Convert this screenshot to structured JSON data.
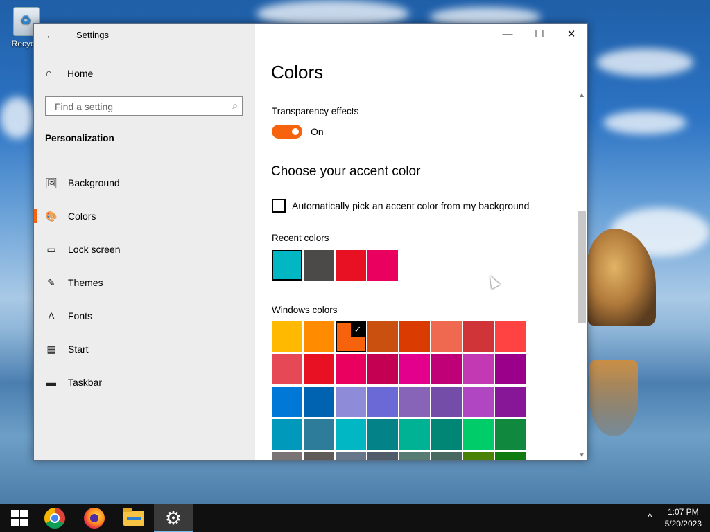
{
  "desktop": {
    "recycle_bin_label": "Recycle"
  },
  "window": {
    "title": "Settings",
    "back_glyph": "←",
    "minimize_glyph": "—",
    "maximize_glyph": "☐",
    "close_glyph": "✕"
  },
  "sidebar": {
    "home_label": "Home",
    "search_placeholder": "Find a setting",
    "section": "Personalization",
    "items": [
      {
        "label": "Background",
        "icon": "picture-icon",
        "glyph": "🖼"
      },
      {
        "label": "Colors",
        "icon": "palette-icon",
        "glyph": "🎨",
        "active": true
      },
      {
        "label": "Lock screen",
        "icon": "lock-screen-icon",
        "glyph": "▭"
      },
      {
        "label": "Themes",
        "icon": "themes-icon",
        "glyph": "✎"
      },
      {
        "label": "Fonts",
        "icon": "fonts-icon",
        "glyph": "A"
      },
      {
        "label": "Start",
        "icon": "start-icon",
        "glyph": "▦"
      },
      {
        "label": "Taskbar",
        "icon": "taskbar-icon",
        "glyph": "▬"
      }
    ]
  },
  "main": {
    "title": "Colors",
    "transparency_label": "Transparency effects",
    "transparency_state": "On",
    "accent_heading": "Choose your accent color",
    "auto_accent_label": "Automatically pick an accent color from my background",
    "recent_label": "Recent colors",
    "windows_label": "Windows colors",
    "recent_colors": [
      "#00b7c3",
      "#4c4a48",
      "#e81123",
      "#ea005e"
    ],
    "windows_colors": [
      [
        "#ffb900",
        "#ff8c00",
        "#f7630c",
        "#ca5010",
        "#da3b01",
        "#ef6950",
        "#d13438",
        "#ff4343"
      ],
      [
        "#e74856",
        "#e81123",
        "#ea005e",
        "#c30052",
        "#e3008c",
        "#bf0077",
        "#c239b3",
        "#9a0089"
      ],
      [
        "#0078d7",
        "#0063b1",
        "#8e8cd8",
        "#6b69d6",
        "#8764b8",
        "#744da9",
        "#b146c2",
        "#881798"
      ],
      [
        "#0099bc",
        "#2d7d9a",
        "#00b7c3",
        "#038387",
        "#00b294",
        "#018574",
        "#00cc6a",
        "#10893e"
      ],
      [
        "#7a7574",
        "#5d5a58",
        "#68768a",
        "#515c6b",
        "#567c73",
        "#486860",
        "#498205",
        "#107c10"
      ]
    ],
    "selected_windows_color": [
      0,
      2
    ],
    "selected_recent_color": 0,
    "accent_color": "#f7630c"
  },
  "taskbar": {
    "apps": [
      "start",
      "chrome",
      "firefox",
      "file-explorer",
      "settings"
    ],
    "time": "1:07 PM",
    "date": "5/20/2023",
    "chevron": "^"
  }
}
